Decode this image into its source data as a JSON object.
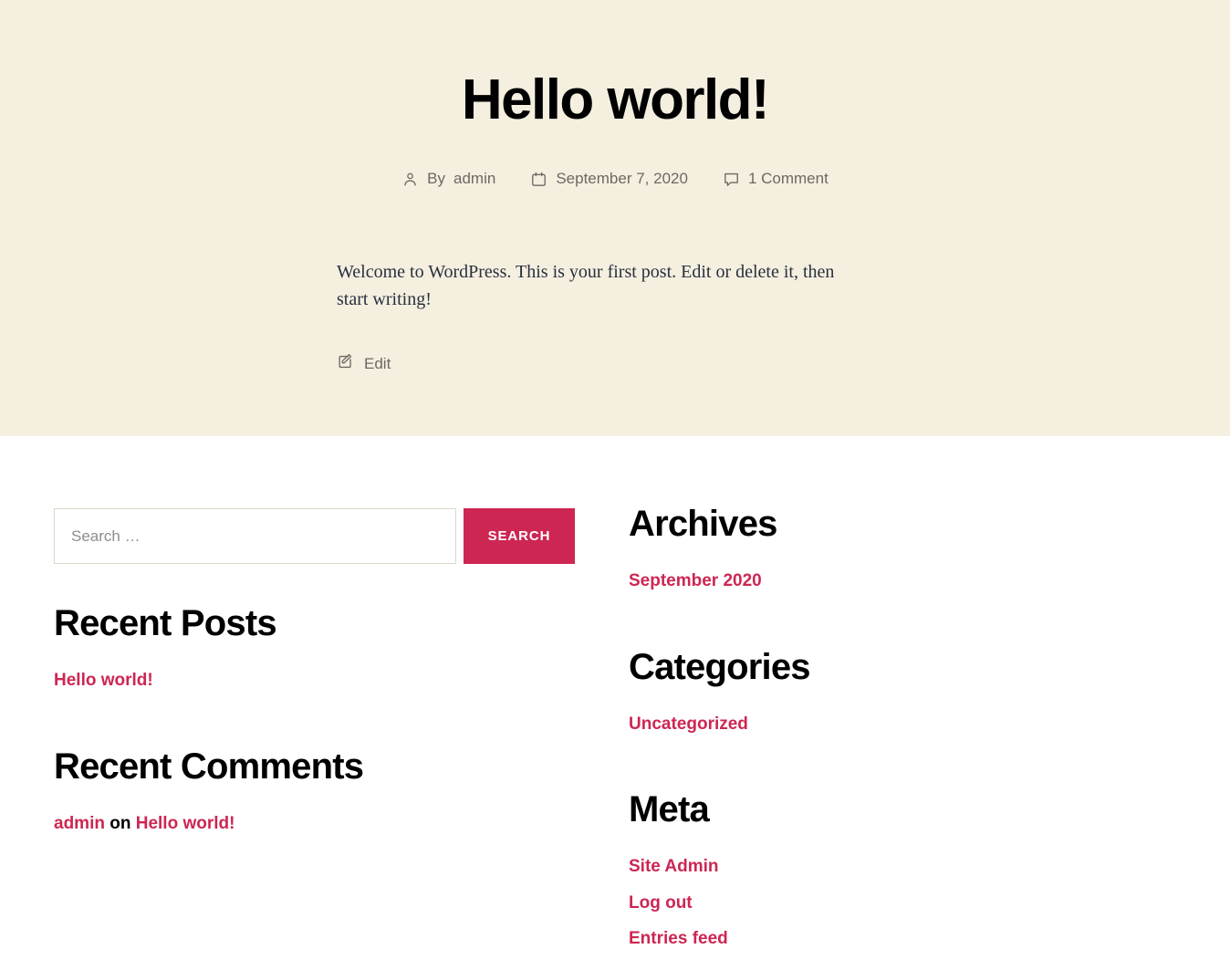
{
  "theme": {
    "header_background": "#f5efe0",
    "accent": "#cd2653",
    "body_background": "#ffffff",
    "meta_text": "#6d6862",
    "heading_text": "#000000"
  },
  "post": {
    "title": "Hello world!",
    "meta": {
      "author_icon": "person-icon",
      "author_prefix": "By ",
      "author_name": "admin",
      "date_icon": "calendar-icon",
      "date": "September 7, 2020",
      "comments_icon": "comment-bubble-icon",
      "comments": "1 Comment"
    },
    "body": "Welcome to WordPress. This is your first post. Edit or delete it, then start writing!",
    "edit_icon": "pencil-square-icon",
    "edit_label": "Edit"
  },
  "search": {
    "placeholder": "Search …",
    "value": "",
    "submit_label": "Search"
  },
  "widgets": {
    "recent_posts": {
      "title": "Recent Posts",
      "items": [
        {
          "label": "Hello world!"
        }
      ]
    },
    "recent_comments": {
      "title": "Recent Comments",
      "items": [
        {
          "author": "admin",
          "separator": " on ",
          "post": "Hello world!"
        }
      ]
    },
    "archives": {
      "title": "Archives",
      "items": [
        {
          "label": "September 2020"
        }
      ]
    },
    "categories": {
      "title": "Categories",
      "items": [
        {
          "label": "Uncategorized"
        }
      ]
    },
    "meta": {
      "title": "Meta",
      "items": [
        {
          "label": "Site Admin"
        },
        {
          "label": "Log out"
        },
        {
          "label": "Entries feed"
        }
      ]
    }
  }
}
